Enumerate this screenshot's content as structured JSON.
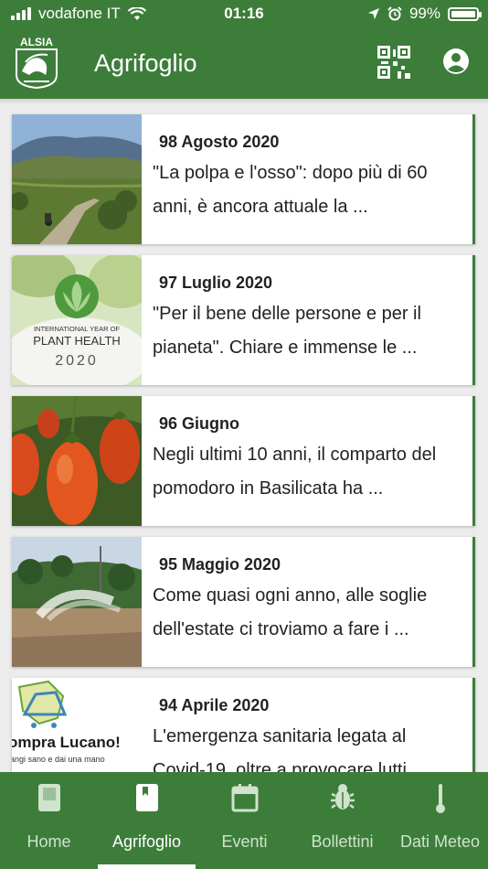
{
  "status_bar": {
    "carrier": "vodafone IT",
    "time": "01:16",
    "battery_percent": "99%"
  },
  "header": {
    "logo_text": "ALSIA",
    "title": "Agrifoglio",
    "icons": [
      "qr-code-icon",
      "account-circle-icon"
    ]
  },
  "articles": [
    {
      "date": "98 Agosto 2020",
      "excerpt": "\"La polpa e l'osso\": dopo più di 60 anni, è ancora attuale la ...",
      "thumb": "mountain-road"
    },
    {
      "date": "97 Luglio 2020",
      "excerpt": "\"Per il bene delle persone e per il pianeta\". Chiare e immense le ...",
      "thumb": "plant-health",
      "thumb_text": {
        "line1": "INTERNATIONAL YEAR OF",
        "line2": "PLANT HEALTH",
        "line3": "2020"
      }
    },
    {
      "date": "96 Giugno",
      "excerpt": "Negli ultimi 10 anni, il comparto del pomodoro in Basilicata ha ...",
      "thumb": "tomatoes"
    },
    {
      "date": "95 Maggio 2020",
      "excerpt": "Come quasi ogni anno, alle soglie dell'estate ci troviamo a fare i ...",
      "thumb": "irrigation"
    },
    {
      "date": "94 Aprile 2020",
      "excerpt": "L'emergenza sanitaria legata al Covid-19, oltre a provocare lutti",
      "thumb": "compra-lucano",
      "thumb_text": {
        "line1": "ompra Lucano!",
        "line2": "angi sano e dai una mano"
      }
    }
  ],
  "tabs": [
    {
      "label": "Home",
      "icon": "book-icon",
      "active": false
    },
    {
      "label": "Agrifoglio",
      "icon": "bookmark-book-icon",
      "active": true
    },
    {
      "label": "Eventi",
      "icon": "calendar-icon",
      "active": false
    },
    {
      "label": "Bollettini",
      "icon": "bug-icon",
      "active": false
    },
    {
      "label": "Dati Meteo",
      "icon": "thermometer-icon",
      "active": false
    }
  ],
  "colors": {
    "primary": "#3d7d3a",
    "background": "#ececec",
    "inactive_tab": "#cfe3cd"
  }
}
